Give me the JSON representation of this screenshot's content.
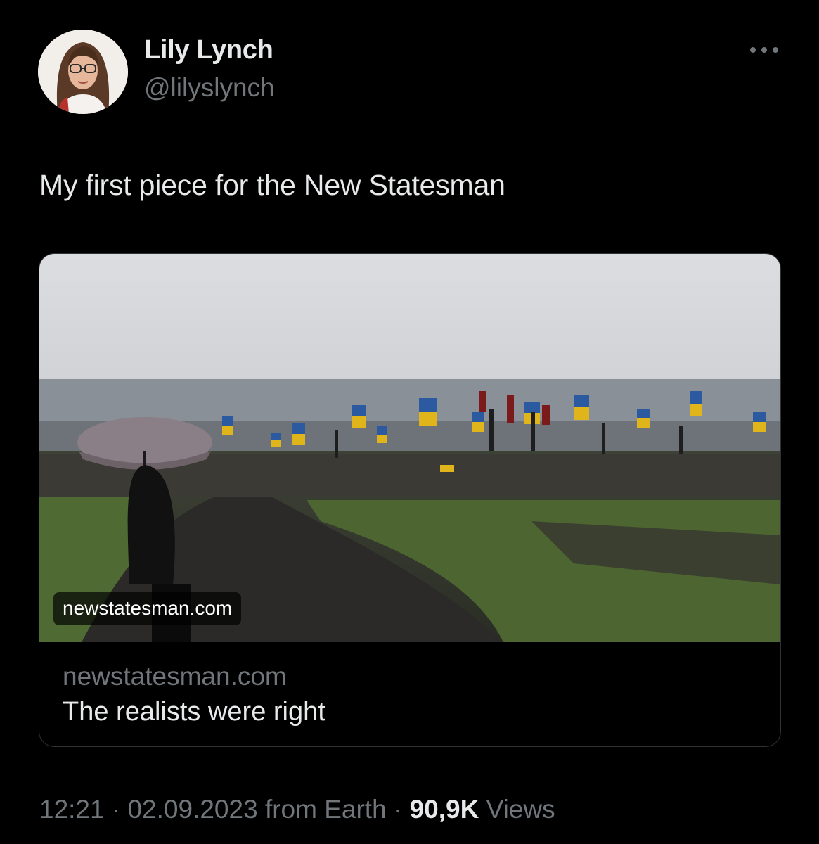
{
  "author": {
    "display_name": "Lily Lynch",
    "handle": "@lilyslynch"
  },
  "icons": {
    "more": "more-horizontal-icon"
  },
  "tweet": {
    "text": "My first piece for the New Statesman"
  },
  "card": {
    "image_overlay_domain": "newstatesman.com",
    "domain": "newstatesman.com",
    "title": "The realists were right"
  },
  "meta": {
    "time": "12:21",
    "separator_1": "·",
    "date": "02.09.2023",
    "source": "from Earth",
    "separator_2": "·",
    "views_count": "90,9K",
    "views_label": "Views"
  },
  "colors": {
    "background": "#000000",
    "primary_text": "#e7e9ea",
    "secondary_text": "#71767b",
    "border": "#2f3336"
  }
}
